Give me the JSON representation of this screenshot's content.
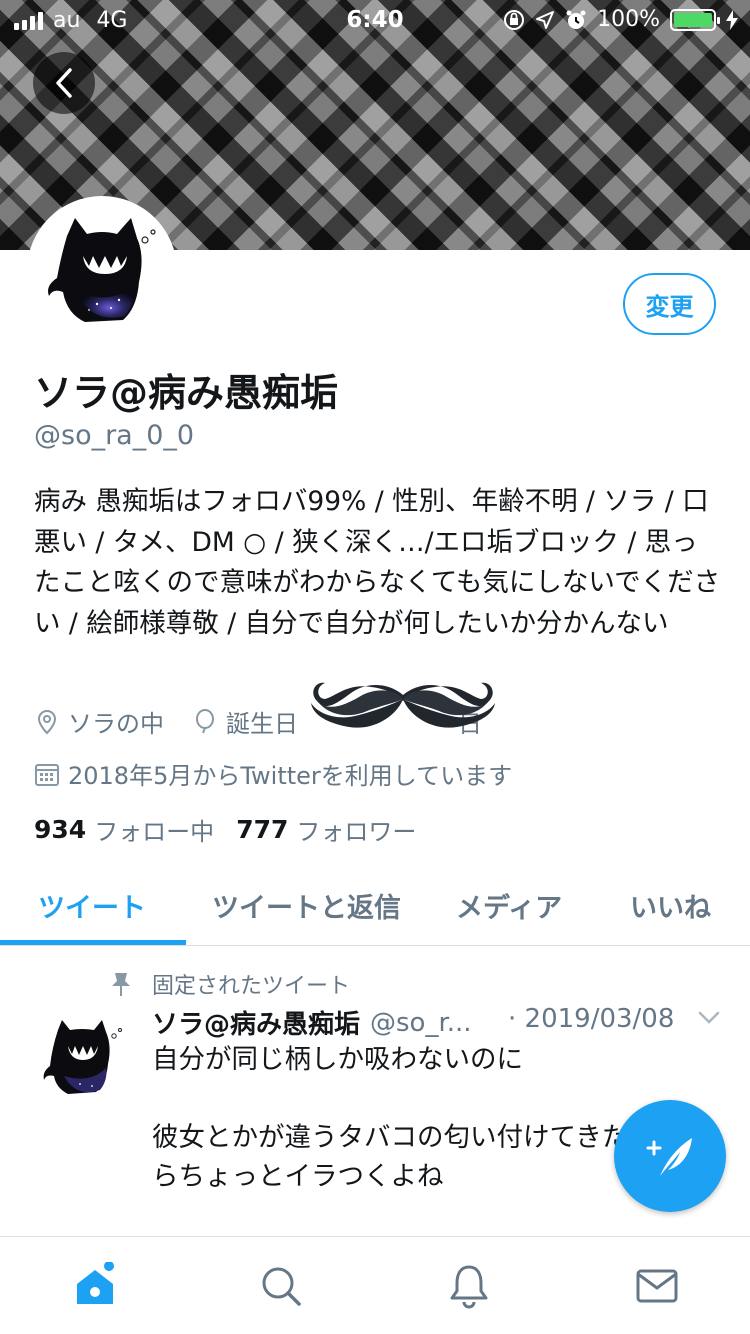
{
  "status_bar": {
    "carrier": "au",
    "network": "4G",
    "time": "6:40",
    "battery_percent": "100%",
    "battery_level": 1.0,
    "battery_color": "#4cd964"
  },
  "header": {
    "back_icon": "chevron-left-icon"
  },
  "profile": {
    "edit_label": "変更",
    "name": "ソラ@病み愚痴垢",
    "handle": "@so_ra_0_0",
    "bio": "病み 愚痴垢はフォロバ99% / 性別、年齢不明 / ソラ / 口悪い / タメ、DM ○ / 狭く深く…/エロ垢ブロック / 思ったこと呟くので意味がわからなくても気にしないでください / 絵師様尊敬 / 自分で自分が何したいか分かんない",
    "location": "ソラの中",
    "birthday_label": "誕生日",
    "birthday_tail": "日",
    "joined": "2018年5月からTwitterを利用しています",
    "following_count": "934",
    "following_label": "フォロー中",
    "followers_count": "777",
    "followers_label": "フォロワー"
  },
  "tabs": [
    {
      "label": "ツイート",
      "active": true
    },
    {
      "label": "ツイートと返信",
      "active": false
    },
    {
      "label": "メディア",
      "active": false
    },
    {
      "label": "いいね",
      "active": false
    }
  ],
  "tweet": {
    "pinned_label": "固定されたツイート",
    "name": "ソラ@病み愚痴垢",
    "handle": "@so_r...",
    "date": "· 2019/03/08",
    "text": "自分が同じ柄しか吸わないのに\n\n彼女とかが違うタバコの匂い付けてきたらちょっとイラつくよね"
  },
  "colors": {
    "accent": "#1da1f2",
    "secondary_text": "#657786",
    "primary_text": "#14171a"
  },
  "bottom_nav": [
    "home-icon",
    "search-icon",
    "notifications-icon",
    "messages-icon"
  ]
}
